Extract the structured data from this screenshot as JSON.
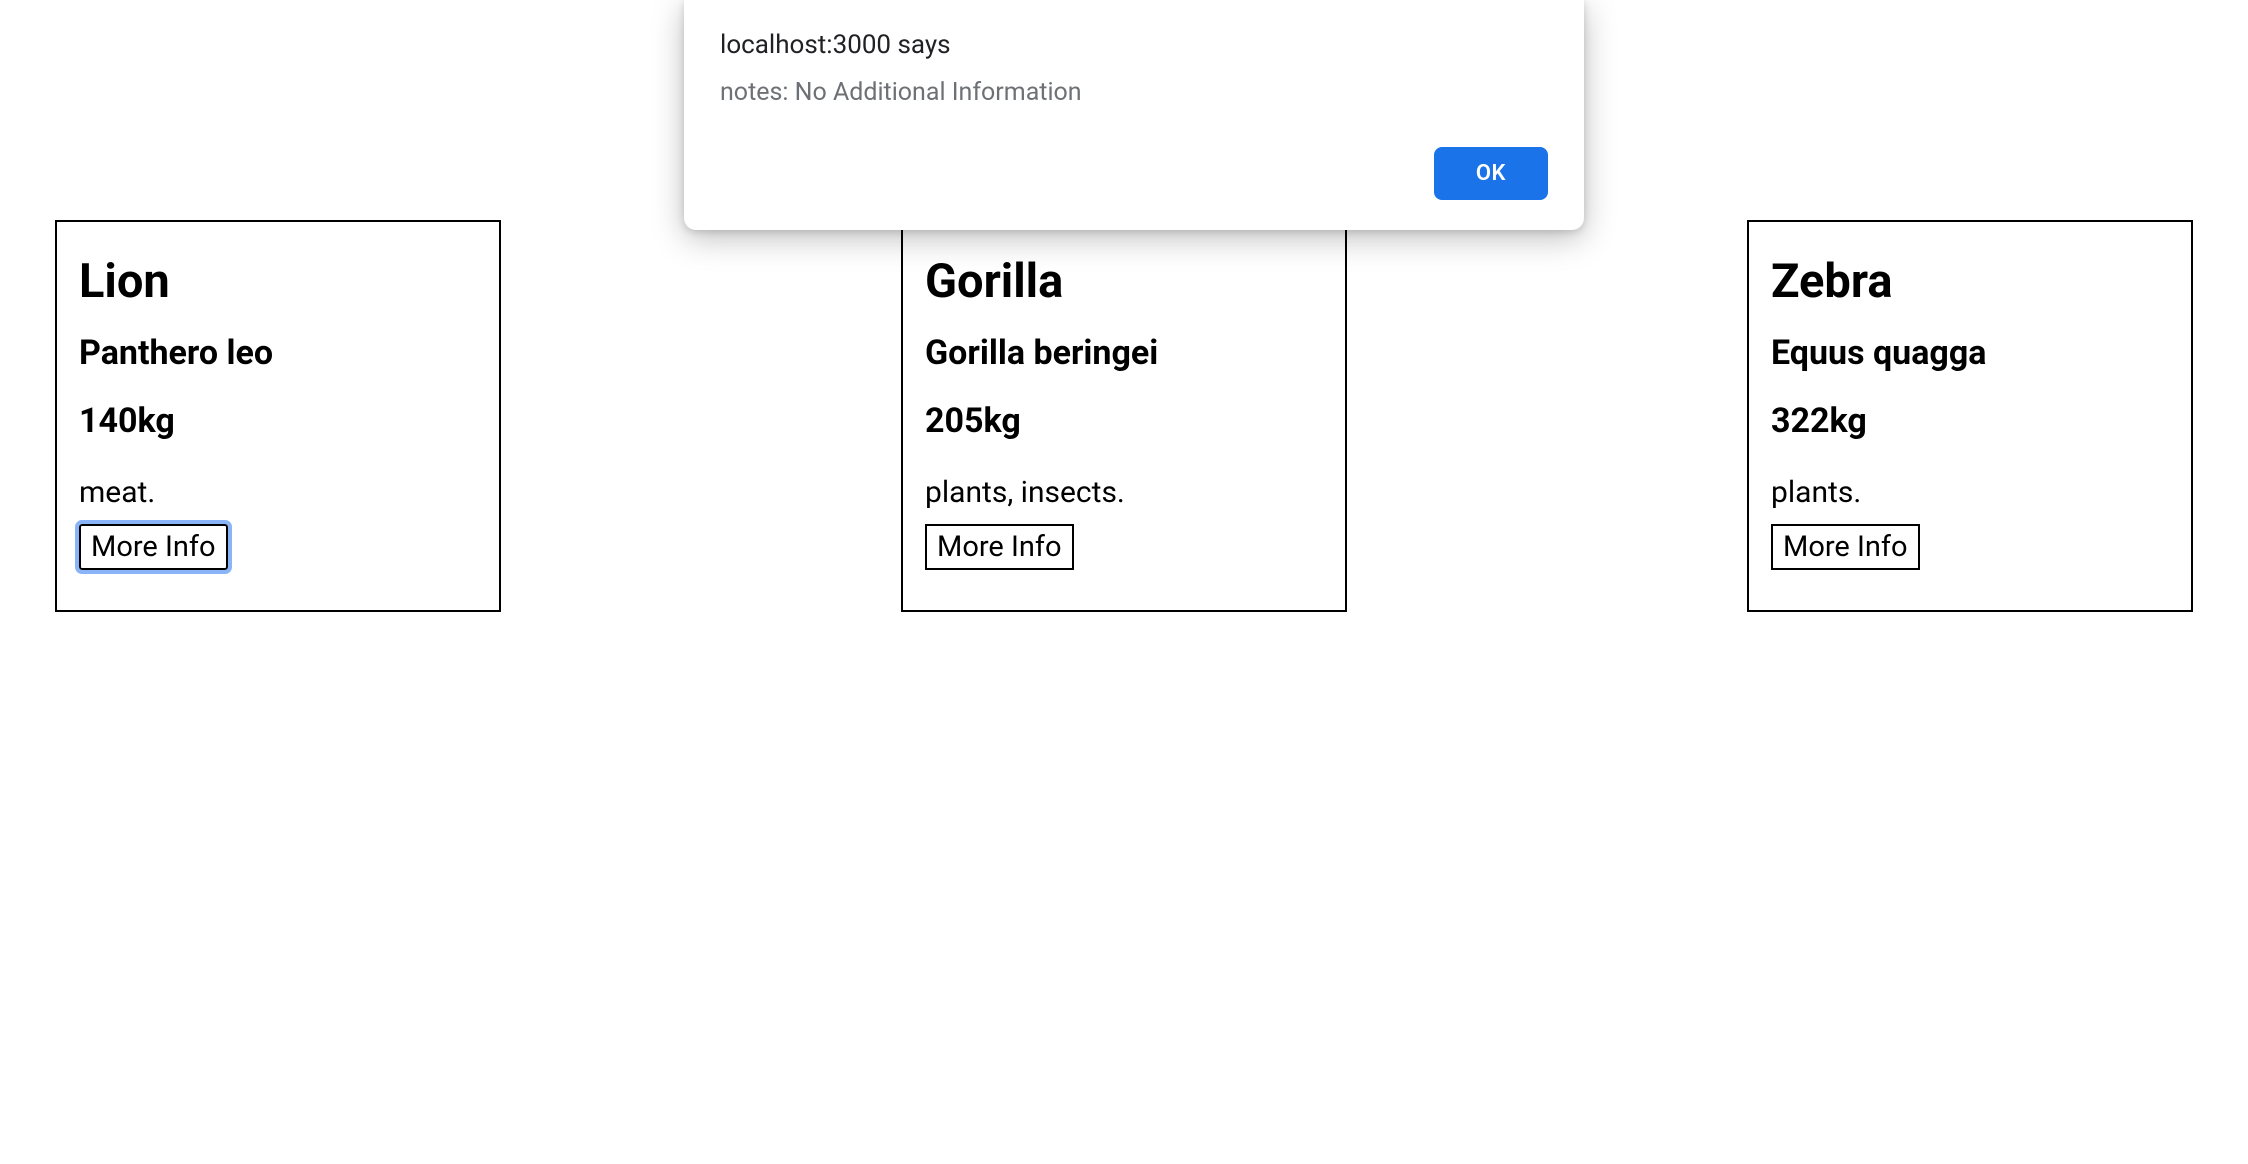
{
  "dialog": {
    "title": "localhost:3000 says",
    "message": "notes: No Additional Information",
    "ok_label": "OK"
  },
  "cards": [
    {
      "name": "Lion",
      "scientific": "Panthero leo",
      "weight": "140kg",
      "diet": "meat.",
      "button_label": "More Info",
      "focused": true
    },
    {
      "name": "Gorilla",
      "scientific": "Gorilla beringei",
      "weight": "205kg",
      "diet": "plants, insects.",
      "button_label": "More Info",
      "focused": false
    },
    {
      "name": "Zebra",
      "scientific": "Equus quagga",
      "weight": "322kg",
      "diet": "plants.",
      "button_label": "More Info",
      "focused": false
    }
  ]
}
